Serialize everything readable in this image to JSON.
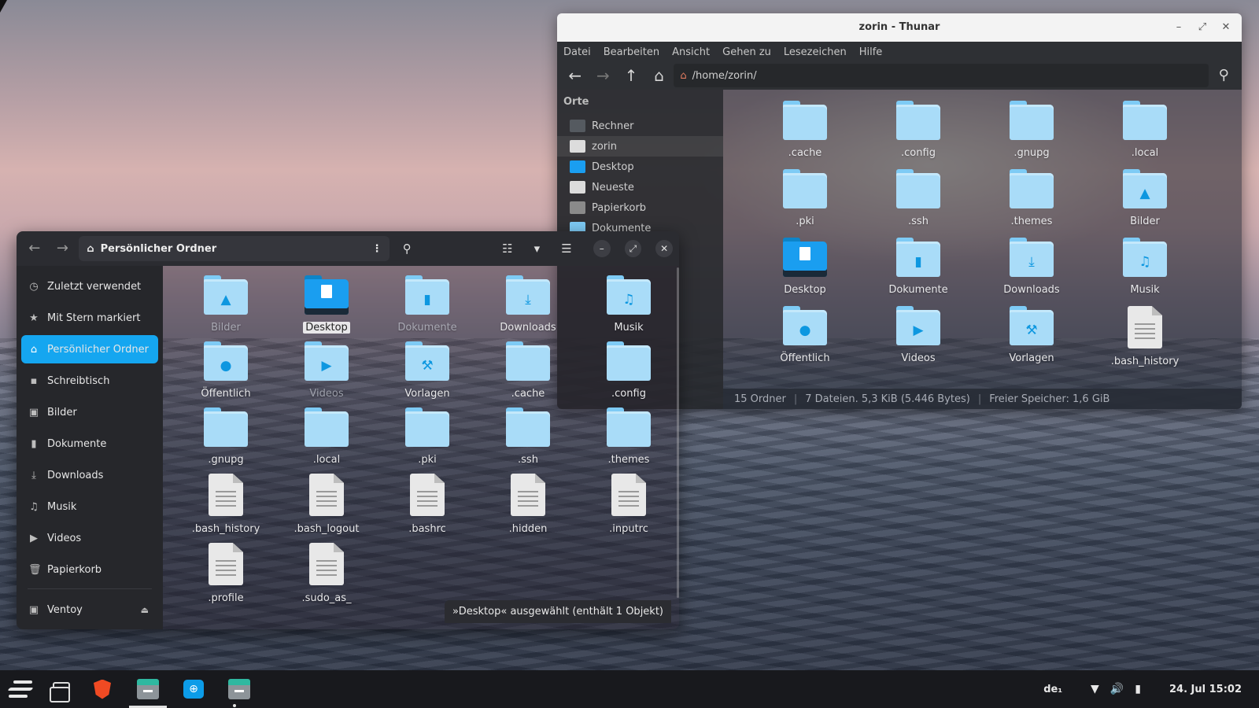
{
  "thunar": {
    "title": "zorin - Thunar",
    "menu": [
      "Datei",
      "Bearbeiten",
      "Ansicht",
      "Gehen zu",
      "Lesezeichen",
      "Hilfe"
    ],
    "location": "/home/zorin/",
    "sidebar_heading": "Orte",
    "sidebar": [
      {
        "label": "Rechner",
        "icon": "computer-icon",
        "color": "#555a60"
      },
      {
        "label": "zorin",
        "icon": "home-icon",
        "color": "#dcdcdc"
      },
      {
        "label": "Desktop",
        "icon": "desktop-icon",
        "color": "#1a9ef0"
      },
      {
        "label": "Neueste",
        "icon": "clock-icon",
        "color": "#dcdcdc"
      },
      {
        "label": "Papierkorb",
        "icon": "trash-icon",
        "color": "#8a8a8a"
      },
      {
        "label": "Dokumente",
        "icon": "folder-icon",
        "color": "#7ecbf5"
      }
    ],
    "items": [
      {
        "label": ".cache",
        "kind": "folder",
        "emblem": ""
      },
      {
        "label": ".config",
        "kind": "folder",
        "emblem": ""
      },
      {
        "label": ".gnupg",
        "kind": "folder",
        "emblem": ""
      },
      {
        "label": ".local",
        "kind": "folder",
        "emblem": ""
      },
      {
        "label": ".pki",
        "kind": "folder",
        "emblem": ""
      },
      {
        "label": ".ssh",
        "kind": "folder",
        "emblem": ""
      },
      {
        "label": ".themes",
        "kind": "folder",
        "emblem": ""
      },
      {
        "label": "Bilder",
        "kind": "folder",
        "emblem": "▲"
      },
      {
        "label": "Desktop",
        "kind": "desktop",
        "emblem": ""
      },
      {
        "label": "Dokumente",
        "kind": "folder",
        "emblem": "▮"
      },
      {
        "label": "Downloads",
        "kind": "folder",
        "emblem": "⤓"
      },
      {
        "label": "Musik",
        "kind": "folder",
        "emblem": "♫"
      },
      {
        "label": "Öffentlich",
        "kind": "folder",
        "emblem": "●"
      },
      {
        "label": "Videos",
        "kind": "folder",
        "emblem": "▶"
      },
      {
        "label": "Vorlagen",
        "kind": "folder",
        "emblem": "⚒"
      },
      {
        "label": ".bash_history",
        "kind": "doc",
        "emblem": ""
      }
    ],
    "status": {
      "folders": "15 Ordner",
      "files": "7 Dateien. 5,3 KiB (5.446 Bytes)",
      "free": "Freier Speicher: 1,6 GiB"
    }
  },
  "files": {
    "path": "Persönlicher Ordner",
    "sidebar": [
      {
        "label": "Zuletzt verwendet",
        "icon": "◷"
      },
      {
        "label": "Mit Stern markiert",
        "icon": "★"
      },
      {
        "label": "Persönlicher Ordner",
        "icon": "⌂",
        "active": true
      },
      {
        "label": "Schreibtisch",
        "icon": "▪"
      },
      {
        "label": "Bilder",
        "icon": "▣"
      },
      {
        "label": "Dokumente",
        "icon": "▮"
      },
      {
        "label": "Downloads",
        "icon": "⤓"
      },
      {
        "label": "Musik",
        "icon": "♫"
      },
      {
        "label": "Videos",
        "icon": "▶"
      },
      {
        "label": "Papierkorb",
        "icon": "🗑"
      }
    ],
    "device": {
      "label": "Ventoy",
      "icon": "▣",
      "eject": "⏏"
    },
    "items": [
      {
        "label": "Bilder",
        "kind": "folder",
        "emblem": "▲",
        "dim": true
      },
      {
        "label": "Desktop",
        "kind": "desktop",
        "emblem": "",
        "selected": true
      },
      {
        "label": "Dokumente",
        "kind": "folder",
        "emblem": "▮",
        "dim": true
      },
      {
        "label": "Downloads",
        "kind": "folder",
        "emblem": "⤓"
      },
      {
        "label": "Musik",
        "kind": "folder",
        "emblem": "♫"
      },
      {
        "label": "Öffentlich",
        "kind": "folder",
        "emblem": "●"
      },
      {
        "label": "Videos",
        "kind": "folder",
        "emblem": "▶",
        "dim": true
      },
      {
        "label": "Vorlagen",
        "kind": "folder",
        "emblem": "⚒"
      },
      {
        "label": ".cache",
        "kind": "folder",
        "emblem": ""
      },
      {
        "label": ".config",
        "kind": "folder",
        "emblem": ""
      },
      {
        "label": ".gnupg",
        "kind": "folder",
        "emblem": ""
      },
      {
        "label": ".local",
        "kind": "folder",
        "emblem": ""
      },
      {
        "label": ".pki",
        "kind": "folder",
        "emblem": ""
      },
      {
        "label": ".ssh",
        "kind": "folder",
        "emblem": ""
      },
      {
        "label": ".themes",
        "kind": "folder",
        "emblem": ""
      },
      {
        "label": ".bash_history",
        "kind": "doc",
        "emblem": ""
      },
      {
        "label": ".bash_logout",
        "kind": "doc",
        "emblem": ""
      },
      {
        "label": ".bashrc",
        "kind": "doc",
        "emblem": ""
      },
      {
        "label": ".hidden",
        "kind": "doc",
        "emblem": ""
      },
      {
        "label": ".inputrc",
        "kind": "doc",
        "emblem": ""
      },
      {
        "label": ".profile",
        "kind": "doc",
        "emblem": ""
      },
      {
        "label": ".sudo_as_",
        "kind": "doc",
        "emblem": ""
      }
    ],
    "status": "»Desktop« ausgewählt  (enthält 1 Objekt)"
  },
  "taskbar": {
    "keyboard_layout": "de₁",
    "datetime": "24. Jul  15:02"
  },
  "colors": {
    "accent": "#15a6f0",
    "folder": "#a9dcf8",
    "emblem": "#0d97e0"
  }
}
